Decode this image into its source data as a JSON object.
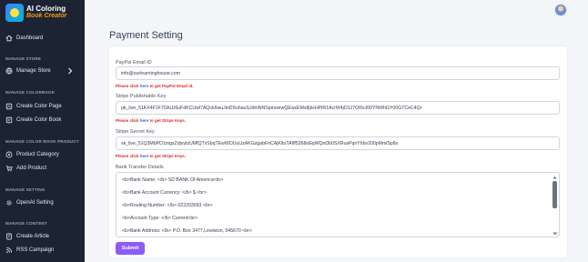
{
  "app": {
    "logo_line1": "AI Coloring",
    "logo_line2": "Book Creator"
  },
  "sidebar": {
    "dashboard": "Dashboard",
    "sections": {
      "manage_store": "MANAGE STORE",
      "manage_colorbook": "MANAGE COLORBOOK",
      "manage_color_book_product": "MANAGE COLOR BOOK PRODUCT",
      "manage_setting": "MANAGE SETTING",
      "manage_content": "MANAGE CONTENT"
    },
    "items": {
      "manage_store": "Manage Store",
      "create_color_page": "Create Color Page",
      "create_color_book": "Create Color Book",
      "product_category": "Product Category",
      "add_product": "Add Product",
      "openai_setting": "OpenAI Setting",
      "create_article": "Create Article",
      "rss_campaign": "RSS Campaign"
    }
  },
  "page": {
    "title": "Payment Setting"
  },
  "form": {
    "paypal": {
      "label": "PayPal Email ID",
      "value": "info@ourlearninghouse.com",
      "note_prefix": "Please click ",
      "note_link": "here",
      "note_suffix": " to get PayPal Email id."
    },
    "stripe_publishable": {
      "label": "Stripe Publishable Key",
      "value": "pk_live_51KX4F1F7Gfu1I6uFdKCUwl7AQck6wuJioDSuhauSJdmNNSpmwewQEwcEMs8jbcHPiR1AcrW4jO1J7ORsJ00YNWhGY00GTCeC4Qr",
      "note_prefix": "Please click ",
      "note_link": "here",
      "note_suffix": " to get Stripe Keys."
    },
    "stripe_secret": {
      "label": "Stripe Secret Key",
      "value": "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",
      "note_prefix": "Please click ",
      "note_link": "here",
      "note_suffix": " to get Stripe Keys."
    },
    "bank": {
      "label": "Bank Transfer Details",
      "lines": [
        "<b>Bank Name: </b> SD BANK Of America<br>",
        "<b>Bank Account Currency: </b> $ <br>",
        "<b>Routing Number:  </b> 022203093 <br>",
        "<b>Account Type:  </b> Current<br>",
        "<b>Bank Address: </b> P.O. Box 3477,Lewiston, 045670  <br>"
      ]
    },
    "submit_label": "Submit"
  },
  "colors": {
    "sidebar_bg": "#1c2333",
    "accent": "#8b5cf6",
    "error": "#dc2626",
    "link": "#2563eb"
  }
}
